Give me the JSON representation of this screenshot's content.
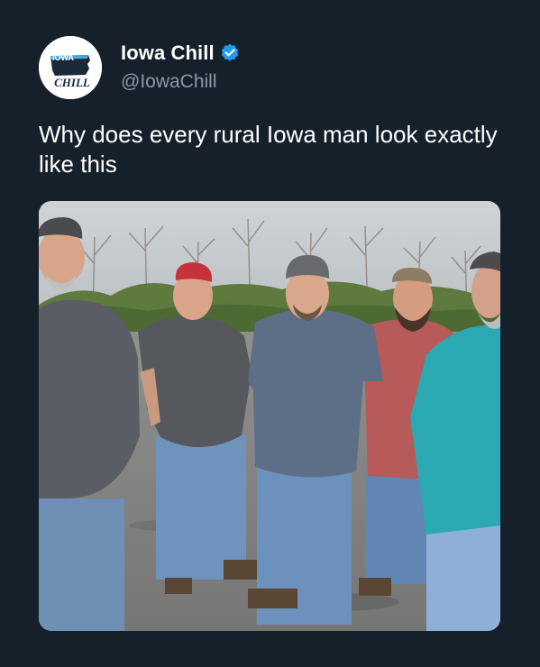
{
  "account": {
    "display_name": "Iowa Chill",
    "handle": "@IowaChill",
    "verified": true,
    "avatar_icon": "iowa-chill-logo-icon",
    "avatar_logo_text_top": "IOWA",
    "avatar_logo_text_bottom": "CHILL"
  },
  "tweet": {
    "text": "Why does every rural Iowa man look exactly like this"
  },
  "media": {
    "type": "photo"
  },
  "colors": {
    "background": "#15202b",
    "text_primary": "#ffffff",
    "text_secondary": "#8b98a5",
    "verified_blue": "#1d9bf0"
  }
}
